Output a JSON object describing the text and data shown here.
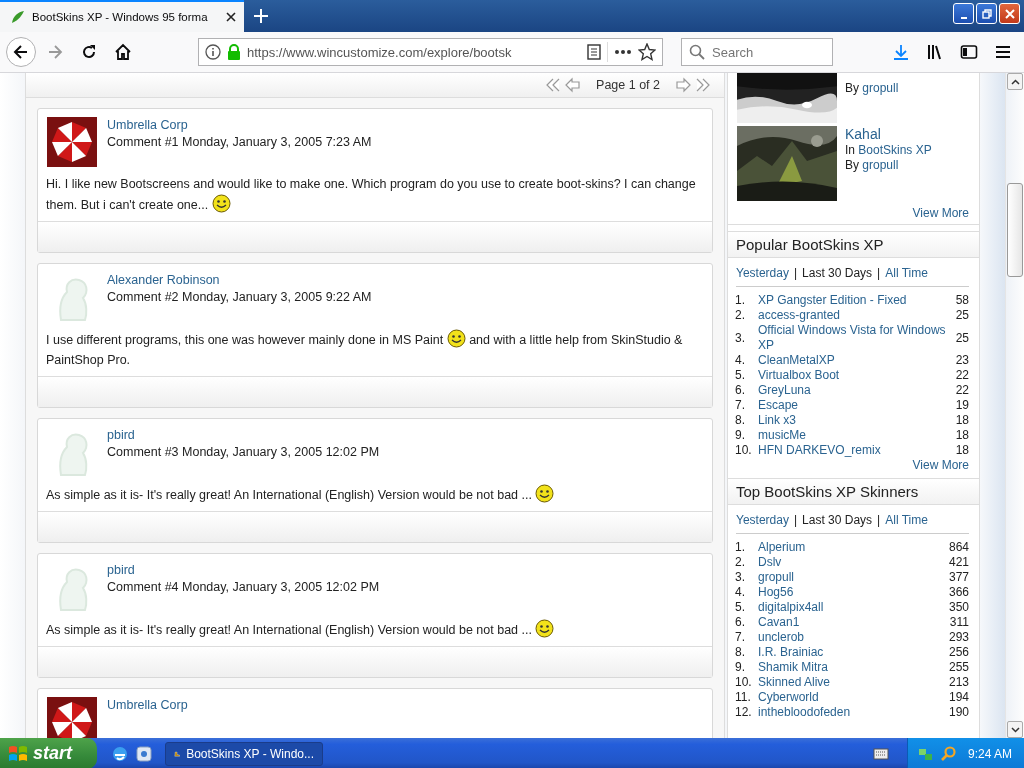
{
  "browser": {
    "tab_title": "BootSkins XP - Windows 95 forma",
    "url": "https://www.wincustomize.com/explore/bootsk",
    "search_placeholder": "Search"
  },
  "pager": {
    "label": "Page 1 of 2"
  },
  "comments": [
    {
      "author": "Umbrella Corp",
      "kind": "logo",
      "meta": "Comment #1 Monday, January 3, 2005 7:23 AM",
      "body": [
        {
          "kind": "text",
          "text": "Hi. I like new Bootscreens and would like to make one. Which program do you use to create boot-skins? I can change them. But i can't create one... "
        },
        {
          "kind": "emoticon"
        }
      ]
    },
    {
      "author": "Alexander Robinson",
      "kind": "placeholder",
      "meta": "Comment #2 Monday, January 3, 2005 9:22 AM",
      "body": [
        {
          "kind": "text",
          "text": "I use different programs, this one was however mainly done in MS Paint "
        },
        {
          "kind": "emoticon"
        },
        {
          "kind": "text",
          "text": " and with a little help from SkinStudio & PaintShop Pro."
        }
      ]
    },
    {
      "author": "pbird",
      "kind": "placeholder",
      "meta": "Comment #3 Monday, January 3, 2005 12:02 PM",
      "body": [
        {
          "kind": "text",
          "text": "As simple as it is- It's really great! An International (English) Version would be not bad ... "
        },
        {
          "kind": "emoticon"
        }
      ]
    },
    {
      "author": "pbird",
      "kind": "placeholder",
      "meta": "Comment #4 Monday, January 3, 2005 12:02 PM",
      "body": [
        {
          "kind": "text",
          "text": "As simple as it is- It's really great! An International (English) Version would be not bad ... "
        },
        {
          "kind": "emoticon"
        }
      ]
    },
    {
      "author": "Umbrella Corp",
      "kind": "logo"
    }
  ],
  "featured": {
    "items": [
      {
        "author_prefix": "By",
        "author": "gropull"
      },
      {
        "title": "Kahal",
        "category_prefix": "In",
        "category": "BootSkins XP",
        "author_prefix": "By",
        "author": "gropull"
      }
    ],
    "view_more": "View More"
  },
  "panels": [
    {
      "title": "Popular BootSkins XP",
      "separator": "|",
      "filters": [
        {
          "label": "Yesterday",
          "selected": false
        },
        {
          "label": "Last 30 Days",
          "selected": true
        },
        {
          "label": "All Time",
          "selected": false
        }
      ],
      "items": [
        {
          "rank": "1.",
          "name": "XP Gangster Edition - Fixed",
          "count": "58"
        },
        {
          "rank": "2.",
          "name": "access-granted",
          "count": "25"
        },
        {
          "rank": "3.",
          "name": "Official Windows Vista for Windows XP",
          "count": "25"
        },
        {
          "rank": "4.",
          "name": "CleanMetalXP",
          "count": "23"
        },
        {
          "rank": "5.",
          "name": "Virtualbox Boot",
          "count": "22"
        },
        {
          "rank": "6.",
          "name": "GreyLuna",
          "count": "22"
        },
        {
          "rank": "7.",
          "name": "Escape",
          "count": "19"
        },
        {
          "rank": "8.",
          "name": "Link x3",
          "count": "18"
        },
        {
          "rank": "9.",
          "name": "musicMe",
          "count": "18"
        },
        {
          "rank": "10.",
          "name": "HFN DARKEVO_remix",
          "count": "18"
        }
      ],
      "view_more": "View More"
    },
    {
      "title": "Top BootSkins XP Skinners",
      "separator": "|",
      "filters": [
        {
          "label": "Yesterday",
          "selected": false
        },
        {
          "label": "Last 30 Days",
          "selected": true
        },
        {
          "label": "All Time",
          "selected": false
        }
      ],
      "items": [
        {
          "rank": "1.",
          "name": "Alperium",
          "count": "864"
        },
        {
          "rank": "2.",
          "name": "Dslv",
          "count": "421"
        },
        {
          "rank": "3.",
          "name": "gropull",
          "count": "377"
        },
        {
          "rank": "4.",
          "name": "Hog56",
          "count": "366"
        },
        {
          "rank": "5.",
          "name": "digitalpix4all",
          "count": "350"
        },
        {
          "rank": "6.",
          "name": "Cavan1",
          "count": "311"
        },
        {
          "rank": "7.",
          "name": "unclerob",
          "count": "293"
        },
        {
          "rank": "8.",
          "name": "I.R. Brainiac",
          "count": "256"
        },
        {
          "rank": "9.",
          "name": "Shamik Mitra",
          "count": "255"
        },
        {
          "rank": "10.",
          "name": "Skinned Alive",
          "count": "213"
        },
        {
          "rank": "11.",
          "name": "Cyberworld",
          "count": "194"
        },
        {
          "rank": "12.",
          "name": "inthebloodofeden",
          "count": "190"
        }
      ]
    }
  ],
  "taskbar": {
    "start": "start",
    "task": "BootSkins XP - Windo...",
    "clock": "9:24 AM"
  }
}
